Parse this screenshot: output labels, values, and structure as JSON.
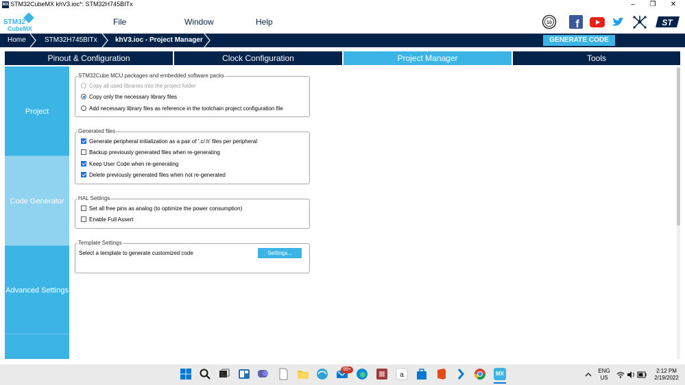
{
  "window": {
    "app_icon_text": "MX",
    "title": "STM32CubeMX khV3.ioc*: STM32H745BITx",
    "minimize": "–",
    "maximize": "❐",
    "close": "✕"
  },
  "logo": {
    "line1": "STM32",
    "line2": "CubeMX"
  },
  "menu": {
    "file": "File",
    "window": "Window",
    "help": "Help"
  },
  "social": {
    "anniversary": "10",
    "facebook": "f",
    "youtube": "▶",
    "twitter": "t",
    "network": "✳",
    "st": "ST"
  },
  "breadcrumb": {
    "home": "Home",
    "mcu": "STM32H745BITx",
    "project": "khV3.ioc - Project Manager"
  },
  "generate_button": "GENERATE CODE",
  "tabs": [
    {
      "label": "Pinout & Configuration"
    },
    {
      "label": "Clock Configuration"
    },
    {
      "label": "Project Manager"
    },
    {
      "label": "Tools"
    }
  ],
  "sidebar": {
    "project": "Project",
    "code_generator": "Code Generator",
    "advanced": "Advanced Settings"
  },
  "packages": {
    "legend": "STM32Cube MCU packages and embedded software packs",
    "opt1": "Copy all used libraries into the project folder",
    "opt2": "Copy only the necessary library files",
    "opt3": "Add necessary library files as reference in the toolchain project configuration file"
  },
  "generated": {
    "legend": "Generated files",
    "opt1": "Generate peripheral initialization as a pair of '.c/.h' files per peripheral",
    "opt2": "Backup previously generated files when re-generating",
    "opt3": "Keep User Code when re-generating",
    "opt4": "Delete previously generated files when not re-generated"
  },
  "hal": {
    "legend": "HAL Settings",
    "opt1": "Set all free pins as analog (to optimize the power consumption)",
    "opt2": "Enable Full Assert"
  },
  "template": {
    "legend": "Template Settings",
    "text": "Select a template to generate customized code",
    "button": "Settings..."
  },
  "taskbar": {
    "mail_badge": "99+",
    "lang1": "ENG",
    "lang2": "US",
    "time": "2:12 PM",
    "date": "2/19/2022",
    "mx_label": "MX"
  },
  "colors": {
    "navy": "#03234b",
    "accent": "#3cb4e5",
    "check": "#1a73e8"
  }
}
